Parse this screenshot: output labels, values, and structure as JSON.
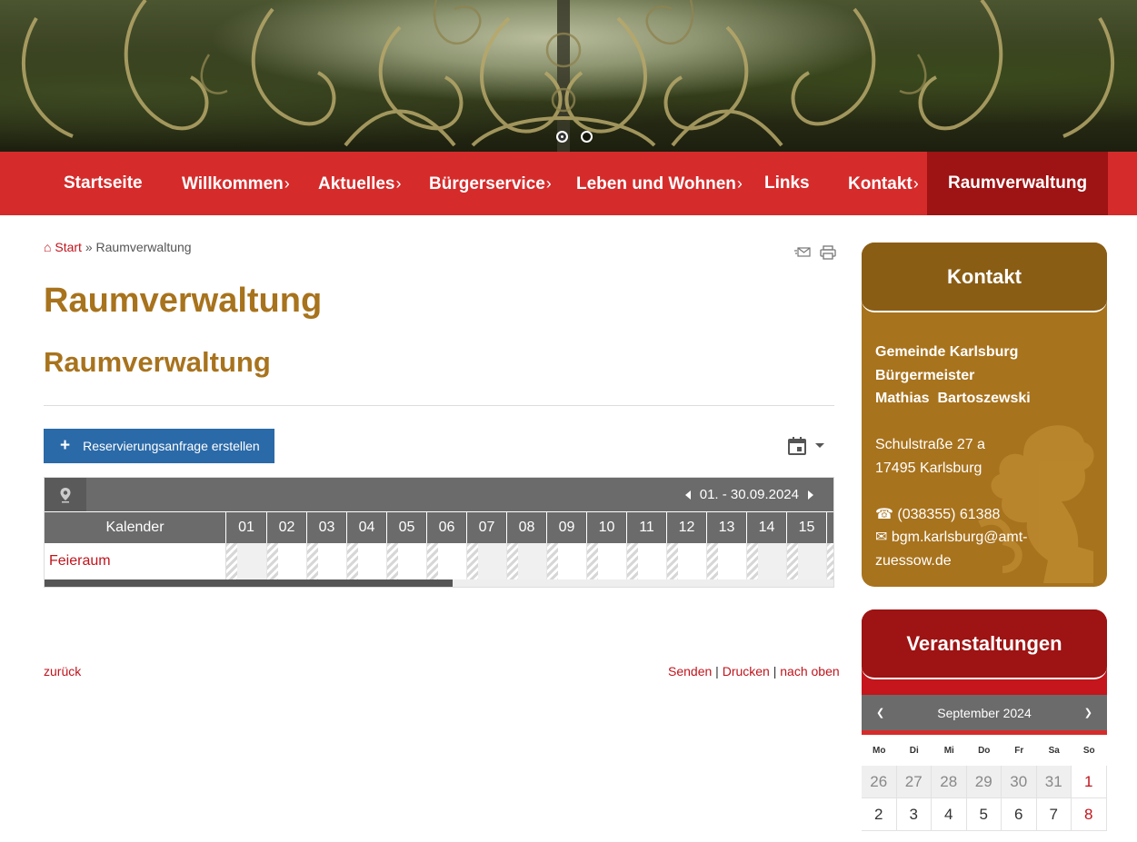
{
  "hero": {
    "slides": 2,
    "active_slide": 1
  },
  "nav": {
    "items": [
      {
        "label": "Startseite",
        "submenu": false
      },
      {
        "label": "Willkommen",
        "submenu": true
      },
      {
        "label": "Aktuelles",
        "submenu": true
      },
      {
        "label": "Bürgerservice",
        "submenu": true
      },
      {
        "label": "Leben und Wohnen",
        "submenu": true
      },
      {
        "label": "Links",
        "submenu": false
      },
      {
        "label": "Kontakt",
        "submenu": true
      },
      {
        "label": "Raumverwaltung",
        "submenu": false,
        "active": true
      }
    ],
    "chevron": "›"
  },
  "breadcrumb": {
    "home_icon": "⌂",
    "home": "Start",
    "separator": "»",
    "current": "Raumverwaltung"
  },
  "page": {
    "title": "Raumverwaltung",
    "subtitle": "Raumverwaltung"
  },
  "reserve_button": {
    "icon": "+",
    "label": "Reservierungsanfrage erstellen"
  },
  "calendar": {
    "period": "01. - 30.09.2024",
    "column_header": "Kalender",
    "days": [
      "01",
      "02",
      "03",
      "04",
      "05",
      "06",
      "07",
      "08",
      "09",
      "10",
      "11",
      "12",
      "13",
      "14",
      "15"
    ],
    "rooms": [
      {
        "name": "Feieraum"
      }
    ]
  },
  "footer": {
    "back": "zurück",
    "send": "Senden",
    "print": "Drucken",
    "top": "nach oben",
    "sep": "|"
  },
  "contact": {
    "title": "Kontakt",
    "org": "Gemeinde Karlsburg",
    "role": "Bürgermeister",
    "person": "Mathias  Bartoszewski",
    "street": "Schulstraße 27 a",
    "city": "17495 Karlsburg",
    "phone_icon": "☎",
    "phone": "(038355) 61388",
    "email_icon": "✉",
    "email_line1": "bgm.karlsburg@amt-",
    "email_line2": "zuessow.de"
  },
  "events": {
    "title": "Veranstaltungen",
    "month": "September 2024",
    "prev": "❮",
    "next": "❯",
    "weekdays": [
      "Mo",
      "Di",
      "Mi",
      "Do",
      "Fr",
      "Sa",
      "So"
    ],
    "week1": [
      "26",
      "27",
      "28",
      "29",
      "30",
      "31",
      "1"
    ],
    "week2": [
      "2",
      "3",
      "4",
      "5",
      "6",
      "7",
      "8"
    ]
  },
  "colors": {
    "nav": "#d62b2b",
    "nav_active": "#9e1313",
    "gold": "#a8731d",
    "link": "#c0141d",
    "button": "#2b6aa8"
  }
}
